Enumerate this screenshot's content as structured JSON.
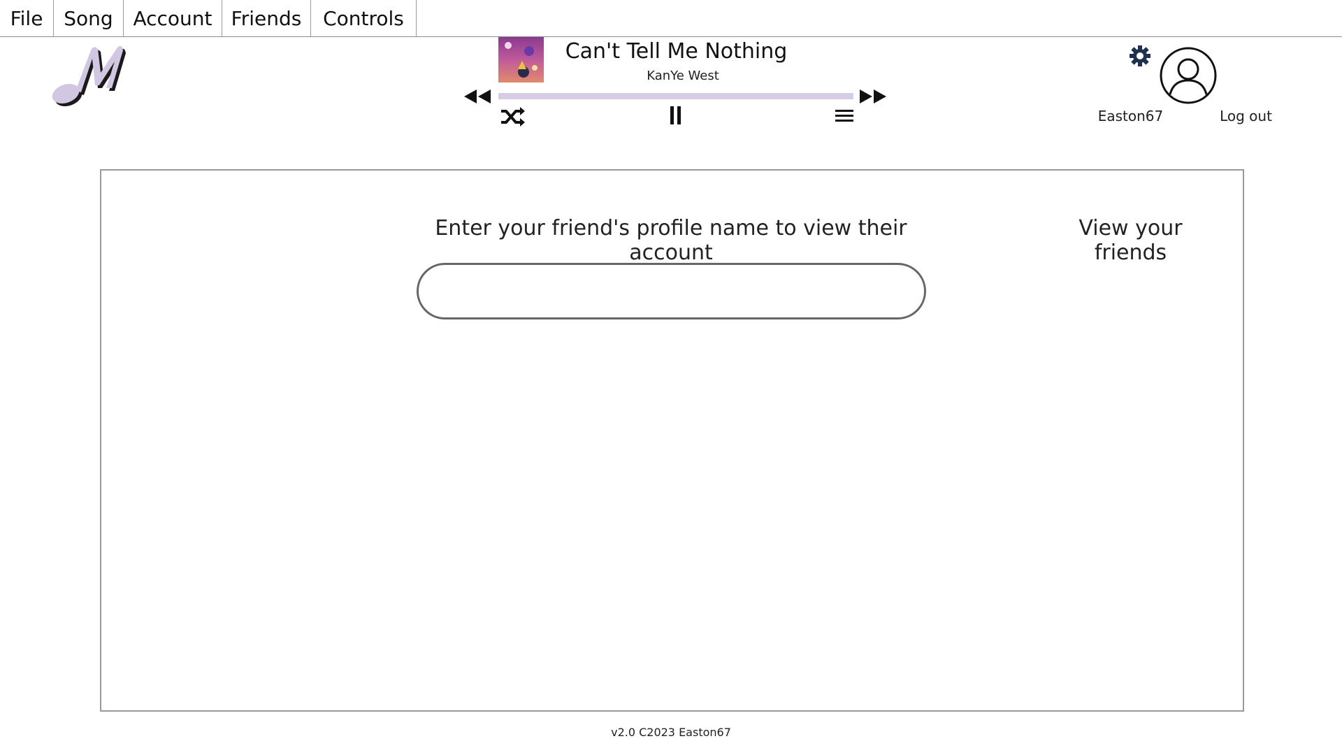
{
  "menu": {
    "items": [
      {
        "label": "File"
      },
      {
        "label": "Song"
      },
      {
        "label": "Account"
      },
      {
        "label": "Friends"
      },
      {
        "label": "Controls"
      }
    ]
  },
  "logo": {
    "icon": "music-note-m-logo",
    "color": "#d2c7e3"
  },
  "player": {
    "song_title": "Can't Tell Me Nothing",
    "artist": "KanYe West",
    "progress": 0,
    "progress_color": "#d6cde4",
    "icons": {
      "rewind": "rewind-icon",
      "fast_forward": "fast-forward-icon",
      "shuffle": "shuffle-icon",
      "pause": "pause-icon",
      "queue": "queue-icon"
    }
  },
  "account": {
    "settings_icon": "gear-icon",
    "settings_color": "#1f3050",
    "avatar_icon": "user-avatar-icon",
    "username": "Easton67",
    "logout_label": "Log out"
  },
  "main": {
    "prompt": "Enter your friend's profile name to view their account",
    "view_friends_label": "View your friends",
    "search": {
      "value": "",
      "placeholder": ""
    }
  },
  "footer": {
    "text": "v2.0 C2023 Easton67"
  }
}
